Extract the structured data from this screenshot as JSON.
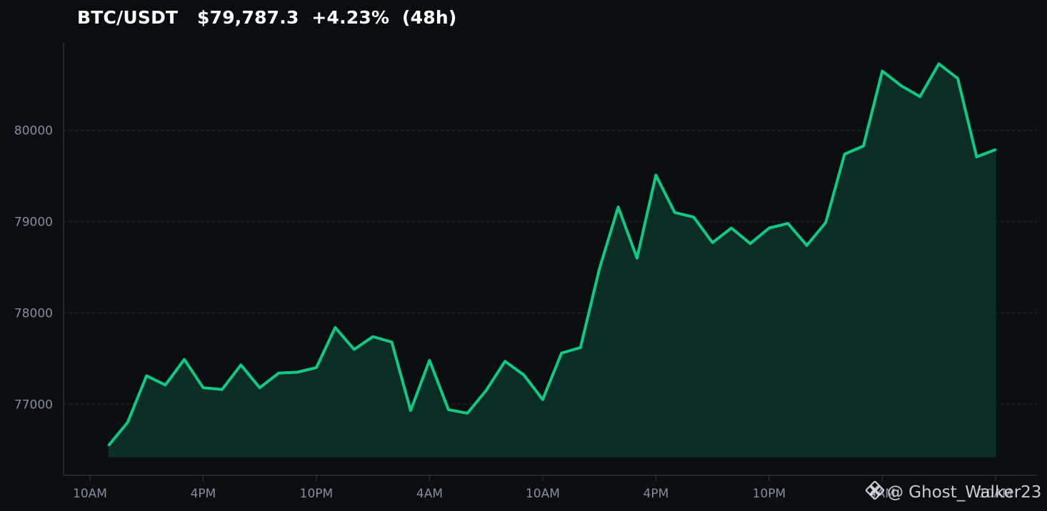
{
  "header": {
    "title": "BTC/USDT   $79,787.3  +4.23%  (48h)"
  },
  "watermark": {
    "text": "@ Ghost_Walker23",
    "icon": "binance-logo-icon"
  },
  "colors": {
    "background": "#0b0e11",
    "line": "#0ecb81",
    "fill": "#0a2e26",
    "grid": "#2b3139",
    "tick": "#848e9c"
  },
  "chart_data": {
    "type": "area",
    "title": "BTC/USDT   $79,787.3  +4.23%  (48h)",
    "xlabel": "",
    "ylabel": "",
    "x_ticks": [
      "10AM",
      "4PM",
      "10PM",
      "4AM",
      "10AM",
      "4PM",
      "10PM",
      "4AM",
      "10AM"
    ],
    "x_tick_hours": [
      0,
      6,
      12,
      18,
      24,
      30,
      36,
      42,
      48
    ],
    "y_ticks": [
      77000,
      78000,
      79000,
      80000
    ],
    "xlim": [
      -1.4,
      50.2
    ],
    "ylim": [
      76220,
      80960
    ],
    "grid": "horizontal dashed",
    "series": [
      {
        "x": [
          1,
          2,
          3,
          4,
          5,
          6,
          7,
          8,
          9,
          10,
          11,
          12,
          13,
          14,
          15,
          16,
          17,
          18,
          19,
          20,
          21,
          22,
          23,
          24,
          25,
          26,
          27,
          28,
          29,
          30,
          31,
          32,
          33,
          34,
          35,
          36,
          37,
          38,
          39,
          40,
          41,
          42,
          43,
          44,
          45,
          46,
          47,
          48
        ],
        "values": [
          76550,
          76800,
          77310,
          77210,
          77490,
          77180,
          77160,
          77430,
          77180,
          77340,
          77350,
          77400,
          77840,
          77600,
          77740,
          77680,
          76930,
          77480,
          76940,
          76900,
          77150,
          77470,
          77320,
          77050,
          77560,
          77620,
          78480,
          79160,
          78600,
          79510,
          79100,
          79050,
          78770,
          78930,
          78760,
          78930,
          78980,
          78740,
          78990,
          79740,
          79830,
          80650,
          80490,
          80370,
          80730,
          80570,
          79710,
          79790
        ]
      }
    ]
  }
}
